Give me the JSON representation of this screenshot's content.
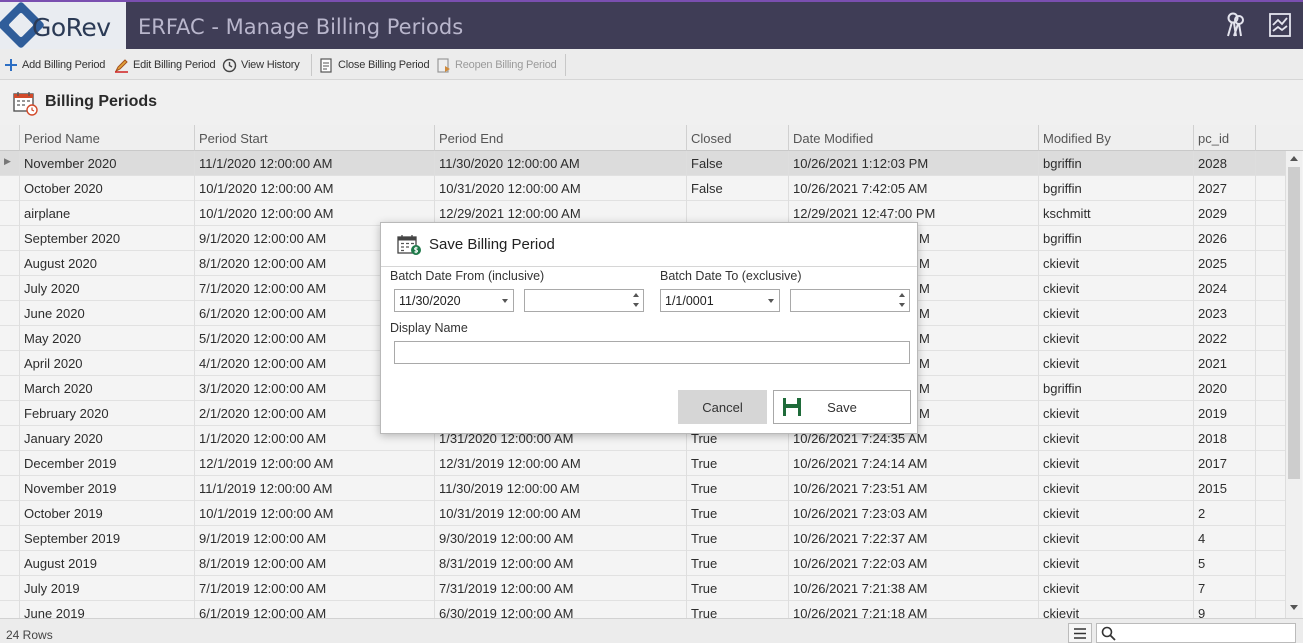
{
  "app": {
    "logo_text": "GoRev",
    "title": "ERFAC - Manage Billing Periods"
  },
  "toolbar": {
    "add": "Add Billing Period",
    "edit": "Edit Billing Period",
    "history": "View History",
    "close": "Close Billing Period",
    "reopen": "Reopen Billing Period"
  },
  "section": {
    "title": "Billing Periods"
  },
  "grid": {
    "columns": [
      "Period Name",
      "Period Start",
      "Period End",
      "Closed",
      "Date Modified",
      "Modified By",
      "pc_id"
    ],
    "rows": [
      [
        "November 2020",
        "11/1/2020 12:00:00 AM",
        "11/30/2020 12:00:00 AM",
        "False",
        "10/26/2021 1:12:03 PM",
        "bgriffin",
        "2028"
      ],
      [
        "October 2020",
        "10/1/2020 12:00:00 AM",
        "10/31/2020 12:00:00 AM",
        "False",
        "10/26/2021 7:42:05 AM",
        "bgriffin",
        "2027"
      ],
      [
        "airplane",
        "10/1/2020 12:00:00 AM",
        "12/29/2021 12:00:00 AM",
        "",
        "12/29/2021 12:47:00 PM",
        "kschmitt",
        "2029"
      ],
      [
        "September 2020",
        "9/1/2020 12:00:00 AM",
        "",
        "",
        "M",
        "bgriffin",
        "2026"
      ],
      [
        "August 2020",
        "8/1/2020 12:00:00 AM",
        "",
        "",
        "M",
        "ckievit",
        "2025"
      ],
      [
        "July 2020",
        "7/1/2020 12:00:00 AM",
        "",
        "",
        "M",
        "ckievit",
        "2024"
      ],
      [
        "June 2020",
        "6/1/2020 12:00:00 AM",
        "",
        "",
        "M",
        "ckievit",
        "2023"
      ],
      [
        "May 2020",
        "5/1/2020 12:00:00 AM",
        "",
        "",
        "M",
        "ckievit",
        "2022"
      ],
      [
        "April 2020",
        "4/1/2020 12:00:00 AM",
        "",
        "",
        "M",
        "ckievit",
        "2021"
      ],
      [
        "March 2020",
        "3/1/2020 12:00:00 AM",
        "",
        "",
        "M",
        "bgriffin",
        "2020"
      ],
      [
        "February 2020",
        "2/1/2020 12:00:00 AM",
        "",
        "",
        "M",
        "ckievit",
        "2019"
      ],
      [
        "January 2020",
        "1/1/2020 12:00:00 AM",
        "1/31/2020 12:00:00 AM",
        "True",
        "10/26/2021 7:24:35 AM",
        "ckievit",
        "2018"
      ],
      [
        "December 2019",
        "12/1/2019 12:00:00 AM",
        "12/31/2019 12:00:00 AM",
        "True",
        "10/26/2021 7:24:14 AM",
        "ckievit",
        "2017"
      ],
      [
        "November 2019",
        "11/1/2019 12:00:00 AM",
        "11/30/2019 12:00:00 AM",
        "True",
        "10/26/2021 7:23:51 AM",
        "ckievit",
        "2015"
      ],
      [
        "October 2019",
        "10/1/2019 12:00:00 AM",
        "10/31/2019 12:00:00 AM",
        "True",
        "10/26/2021 7:23:03 AM",
        "ckievit",
        "2"
      ],
      [
        "September 2019",
        "9/1/2019 12:00:00 AM",
        "9/30/2019 12:00:00 AM",
        "True",
        "10/26/2021 7:22:37 AM",
        "ckievit",
        "4"
      ],
      [
        "August 2019",
        "8/1/2019 12:00:00 AM",
        "8/31/2019 12:00:00 AM",
        "True",
        "10/26/2021 7:22:03 AM",
        "ckievit",
        "5"
      ],
      [
        "July 2019",
        "7/1/2019 12:00:00 AM",
        "7/31/2019 12:00:00 AM",
        "True",
        "10/26/2021 7:21:38 AM",
        "ckievit",
        "7"
      ],
      [
        "June 2019",
        "6/1/2019 12:00:00 AM",
        "6/30/2019 12:00:00 AM",
        "True",
        "10/26/2021 7:21:18 AM",
        "ckievit",
        "9"
      ]
    ]
  },
  "status": {
    "rows_count": "24 Rows"
  },
  "dialog": {
    "title": "Save Billing Period",
    "from_label": "Batch Date From (inclusive)",
    "from_date": "11/30/2020",
    "from_time": "",
    "to_label": "Batch Date To (exclusive)",
    "to_date": "1/1/0001",
    "to_time": "",
    "display_name_label": "Display Name",
    "display_name_value": "",
    "cancel": "Cancel",
    "save": "Save"
  },
  "colors": {
    "titlebar": "#3f3d56",
    "accent": "#7a4fb0",
    "save_icon": "#1f6b3a"
  }
}
